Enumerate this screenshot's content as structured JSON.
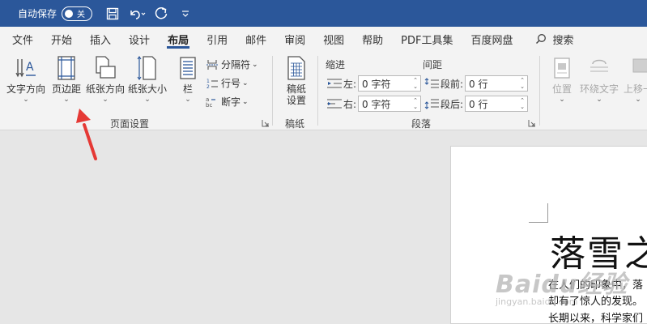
{
  "titlebar": {
    "autosave_label": "自动保存",
    "autosave_state": "关",
    "icons": [
      "save-icon",
      "undo-icon",
      "redo-icon",
      "customize-quick-access-icon"
    ]
  },
  "tabs": [
    "文件",
    "开始",
    "插入",
    "设计",
    "布局",
    "引用",
    "邮件",
    "审阅",
    "视图",
    "帮助",
    "PDF工具集",
    "百度网盘"
  ],
  "active_tab": "布局",
  "search_label": "搜索",
  "ribbon": {
    "page_setup": {
      "label": "页面设置",
      "text_direction": "文字方向",
      "margins": "页边距",
      "orientation": "纸张方向",
      "size": "纸张大小",
      "columns": "栏",
      "breaks": "分隔符",
      "line_numbers": "行号",
      "hyphenation": "断字"
    },
    "manuscript": {
      "label": "稿纸",
      "settings_line1": "稿纸",
      "settings_line2": "设置"
    },
    "paragraph": {
      "label": "段落",
      "indent_title": "缩进",
      "spacing_title": "间距",
      "left_label": "左:",
      "left_value": "0 字符",
      "right_label": "右:",
      "right_value": "0 字符",
      "before_label": "段前:",
      "before_value": "0 行",
      "after_label": "段后:",
      "after_value": "0 行"
    },
    "arrange": {
      "position": "位置",
      "wrap_text": "环绕文字",
      "bring_forward": "上移一"
    }
  },
  "document": {
    "title": "落雪之",
    "lines": [
      "在人们的印象中，落",
      "却有了惊人的发现。",
      "长期以来，科学家们"
    ]
  },
  "watermark": {
    "main": "Baidu经验",
    "sub": "jingyan.baidu.com"
  },
  "colors": {
    "titlebar": "#2b579a",
    "ribbon": "#f3f3f3",
    "arrow": "#e53935"
  }
}
